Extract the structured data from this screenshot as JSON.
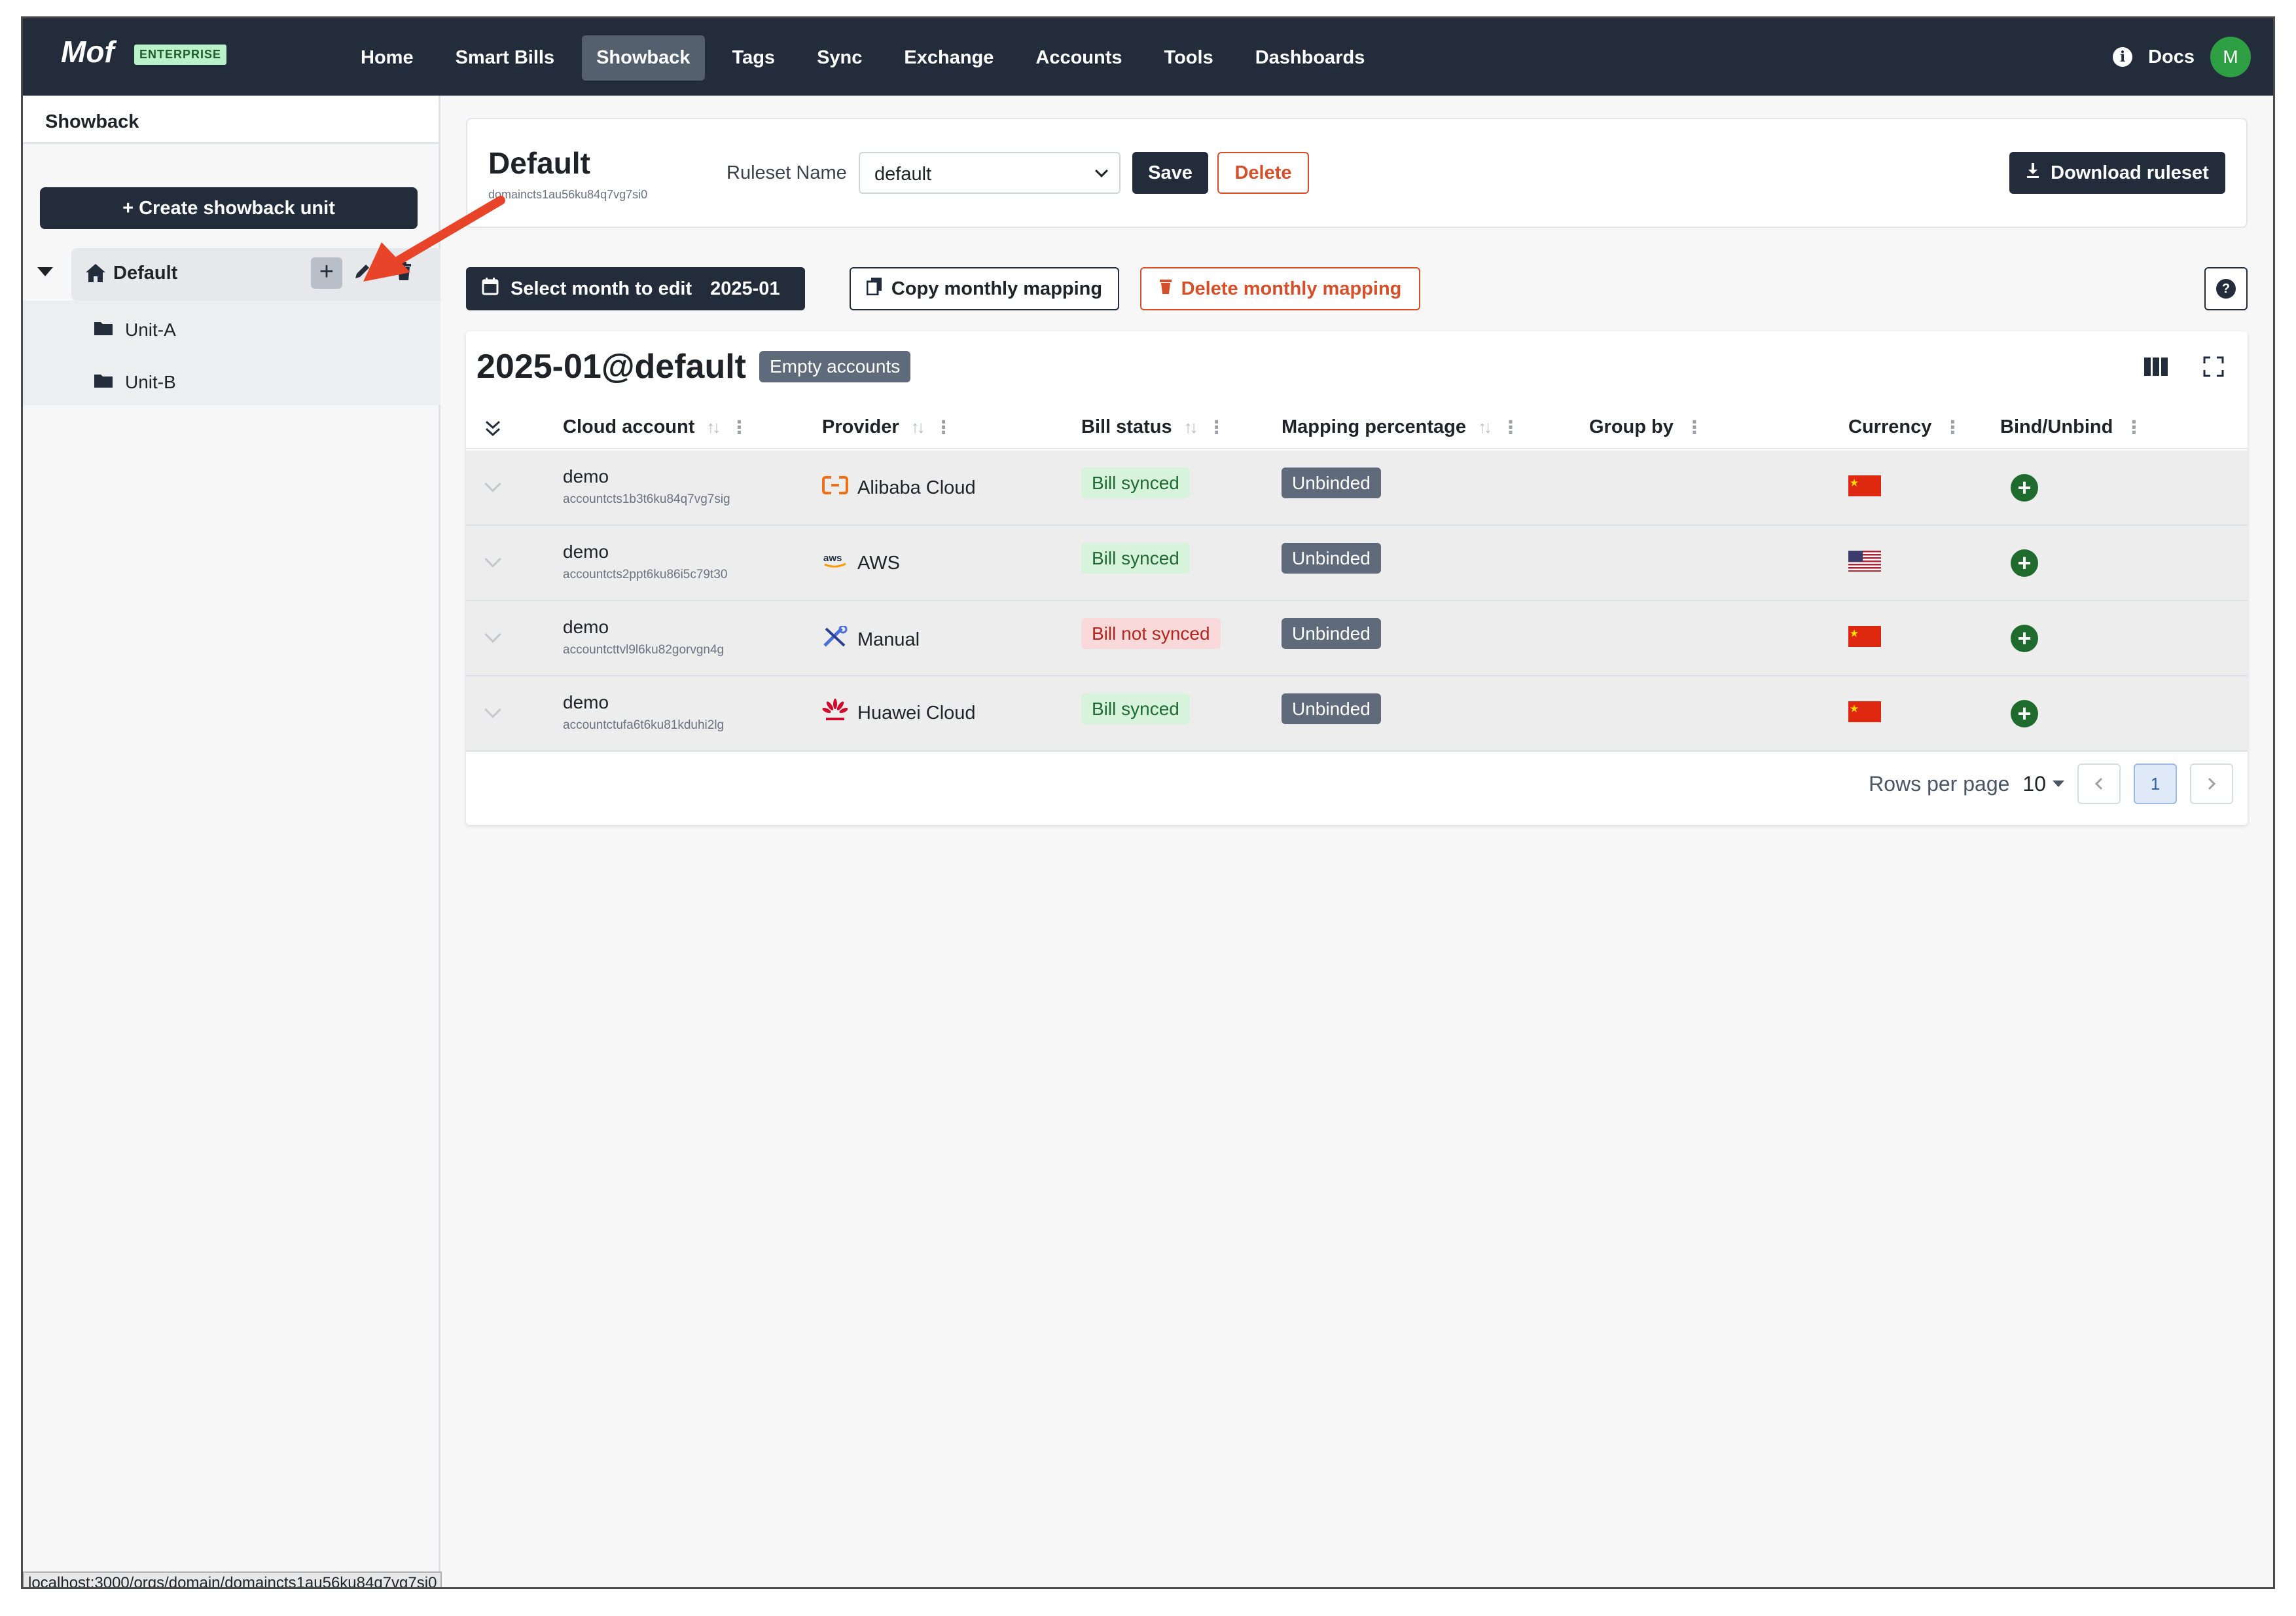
{
  "app": {
    "logo": "Mof",
    "edition_badge": "ENTERPRISE"
  },
  "nav": {
    "items": [
      "Home",
      "Smart Bills",
      "Showback",
      "Tags",
      "Sync",
      "Exchange",
      "Accounts",
      "Tools",
      "Dashboards"
    ],
    "active": "Showback",
    "docs_label": "Docs",
    "avatar_initial": "M"
  },
  "sidebar": {
    "title": "Showback",
    "create_button": "+ Create showback unit",
    "root": {
      "label": "Default"
    },
    "children": [
      {
        "label": "Unit-A"
      },
      {
        "label": "Unit-B"
      }
    ]
  },
  "header": {
    "title": "Default",
    "subtitle": "domaincts1au56ku84q7vg7si0",
    "ruleset_label": "Ruleset Name",
    "ruleset_value": "default",
    "save_label": "Save",
    "delete_label": "Delete",
    "download_label": "Download ruleset"
  },
  "toolbar": {
    "select_month_label": "Select month to edit",
    "month_value": "2025-01",
    "copy_label": "Copy monthly mapping",
    "delete_label": "Delete monthly mapping",
    "help_label": "?"
  },
  "table": {
    "title": "2025-01@default",
    "badge": "Empty accounts",
    "columns": [
      "Cloud account",
      "Provider",
      "Bill status",
      "Mapping percentage",
      "Group by",
      "Currency",
      "Bind/Unbind"
    ],
    "rows": [
      {
        "name": "demo",
        "id": "accountcts1b3t6ku84q7vg7sig",
        "provider": "Alibaba Cloud",
        "provider_icon": "alibaba-cloud-icon",
        "bill_status": "Bill synced",
        "bill_ok": true,
        "mapping": "Unbinded",
        "currency_flag": "china-flag-icon"
      },
      {
        "name": "demo",
        "id": "accountcts2ppt6ku86i5c79t30",
        "provider": "AWS",
        "provider_icon": "aws-icon",
        "bill_status": "Bill synced",
        "bill_ok": true,
        "mapping": "Unbinded",
        "currency_flag": "usa-flag-icon"
      },
      {
        "name": "demo",
        "id": "accountcttvl9l6ku82gorvgn4g",
        "provider": "Manual",
        "provider_icon": "manual-tools-icon",
        "bill_status": "Bill not synced",
        "bill_ok": false,
        "mapping": "Unbinded",
        "currency_flag": "china-flag-icon"
      },
      {
        "name": "demo",
        "id": "accountctufa6t6ku81kduhi2lg",
        "provider": "Huawei Cloud",
        "provider_icon": "huawei-cloud-icon",
        "bill_status": "Bill synced",
        "bill_ok": true,
        "mapping": "Unbinded",
        "currency_flag": "china-flag-icon"
      }
    ],
    "rows_per_page_label": "Rows per page",
    "rows_per_page_value": "10",
    "current_page": "1"
  },
  "status_bar": {
    "url": "localhost:3000/orgs/domain/domaincts1au56ku84q7vg7si0"
  },
  "colors": {
    "nav_bg": "#232c3b",
    "accent_danger": "#d4502b",
    "success": "#1f6b2e",
    "arrow": "#e8442a"
  }
}
